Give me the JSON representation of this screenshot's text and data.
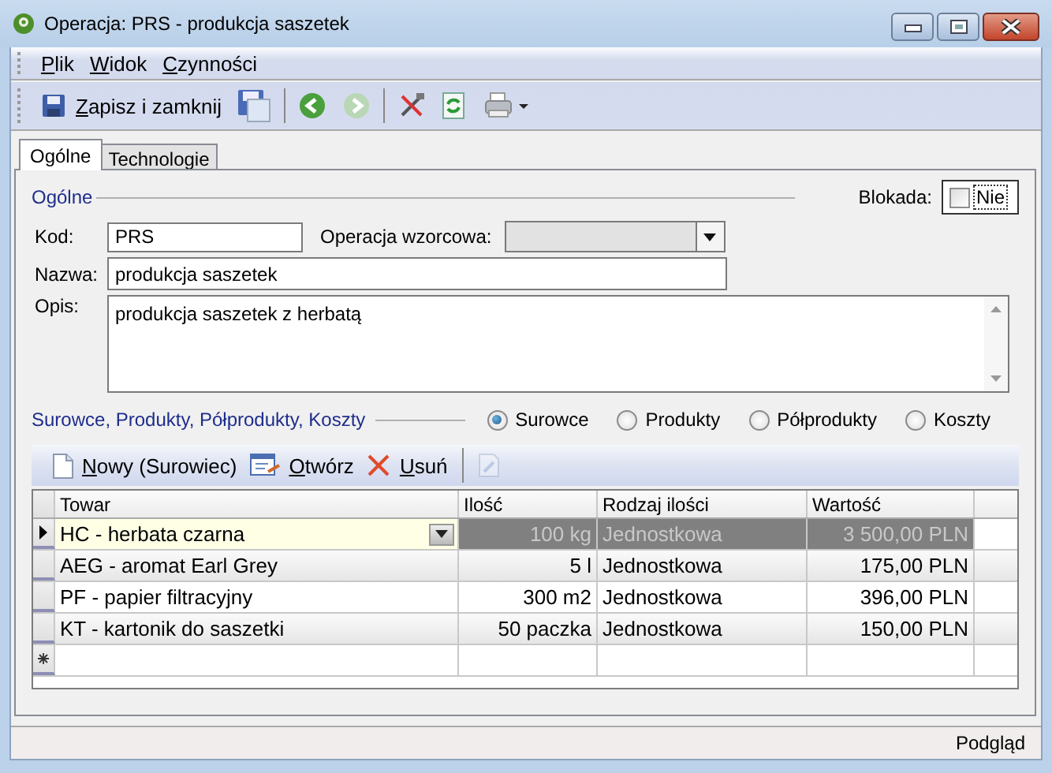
{
  "window": {
    "title": "Operacja: PRS - produkcja saszetek"
  },
  "menu": [
    "Plik",
    "Widok",
    "Czynności"
  ],
  "toolbar": {
    "save_close_label": "Zapisz i zamknij",
    "back": {
      "disabled": false
    },
    "forward": {
      "disabled": true
    }
  },
  "tabs": [
    {
      "label": "Ogólne",
      "selected": true
    },
    {
      "label": "Technologie",
      "selected": false
    }
  ],
  "general": {
    "section_title": "Ogólne",
    "lock": {
      "label": "Blokada:",
      "checked": false,
      "value": "Nie"
    },
    "code": {
      "label": "Kod:",
      "value": "PRS"
    },
    "template": {
      "label": "Operacja wzorcowa:",
      "disabled": true
    },
    "name": {
      "label": "Nazwa:",
      "value": "produkcja saszetek"
    },
    "description": {
      "label": "Opis:",
      "value": "produkcja saszetek z herbatą"
    }
  },
  "items": {
    "section_title": "Surowce, Produkty, Półprodukty, Koszty",
    "options": [
      {
        "label": "Surowce",
        "selected": true
      },
      {
        "label": "Produkty",
        "selected": false
      },
      {
        "label": "Półprodukty",
        "selected": false
      },
      {
        "label": "Koszty",
        "selected": false
      }
    ],
    "actions": [
      {
        "kind": "new",
        "label": "Nowy (Surowiec)"
      },
      {
        "kind": "open",
        "label": "Otwórz"
      },
      {
        "kind": "delete",
        "label": "Usuń"
      },
      {
        "kind": "edit",
        "disabled": true
      }
    ],
    "table": {
      "columns": [
        {
          "label": "Towar",
          "kind": "text"
        },
        {
          "label": "Ilość",
          "kind": "number"
        },
        {
          "label": "Rodzaj ilości",
          "kind": "text"
        },
        {
          "label": "Wartość",
          "kind": "number"
        }
      ],
      "rows": [
        {
          "cells": [
            "HC - herbata czarna",
            "100 kg",
            "Jednostkowa",
            "3 500,00 PLN"
          ],
          "selected": true
        },
        {
          "cells": [
            "AEG - aromat Earl Grey",
            "5 l",
            "Jednostkowa",
            "175,00 PLN"
          ],
          "selected": false
        },
        {
          "cells": [
            "PF - papier filtracyjny",
            "300 m2",
            "Jednostkowa",
            "396,00 PLN"
          ],
          "selected": false
        },
        {
          "cells": [
            "KT - kartonik do saszetki",
            "50 paczka",
            "Jednostkowa",
            "150,00 PLN"
          ],
          "selected": false
        }
      ]
    }
  },
  "status_bar": {
    "mode": "Podgląd"
  }
}
